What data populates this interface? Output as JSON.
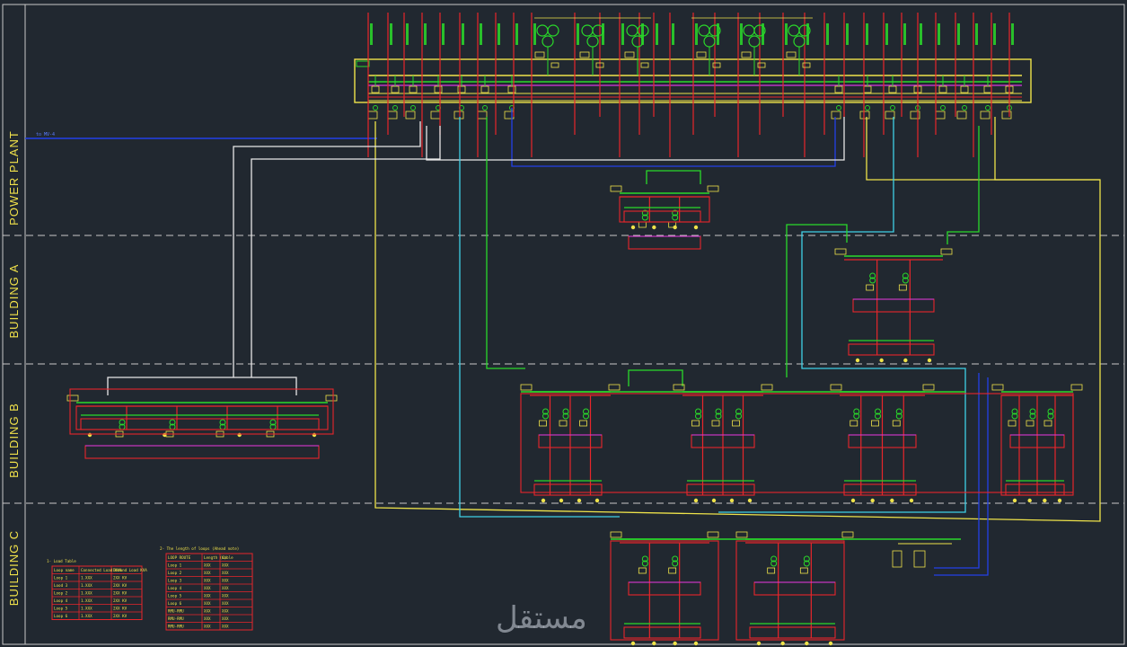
{
  "zones": [
    "POWER PLANT",
    "BUILDING A",
    "BUILDING B",
    "BUILDING C"
  ],
  "incoming_feeder": "to MV-4",
  "load_table": {
    "title": "1- Load Table",
    "header": [
      "Loop name",
      "Connected Load KVA",
      "Demand Load KVA"
    ],
    "rows": [
      [
        "Loop 1",
        "1.XXX",
        "2XX KV"
      ],
      [
        "Lood 3",
        "1.XXX",
        "2XX KV"
      ],
      [
        "Loop 2",
        "1.XXX",
        "2XX KV"
      ],
      [
        "Loop 4",
        "1.XXX",
        "2XX KV"
      ],
      [
        "Loop 5",
        "1.XXX",
        "2XX KV"
      ],
      [
        "Loop 6",
        "1.XXX",
        "2XX KV"
      ]
    ]
  },
  "cable_table": {
    "title": "2- The length of loops (Ahead note)",
    "header": [
      "LOOP ROUTE",
      "Length",
      "(m)",
      "Cable"
    ],
    "rows": [
      [
        "Loop 1",
        "XXX",
        "XXX"
      ],
      [
        "Loop 2",
        "XXX",
        "XXX"
      ],
      [
        "Loop 3",
        "XXX",
        "XXX"
      ],
      [
        "Loop 4",
        "XXX",
        "XXX"
      ],
      [
        "Loop 5",
        "XXX",
        "XXX"
      ],
      [
        "Loop 6",
        "XXX",
        "XXX"
      ],
      [
        "RMU-RMU",
        "XXX",
        "XXX"
      ],
      [
        "RMU-RMU",
        "XXX",
        "XXX"
      ],
      [
        "RMU-RMU",
        "XXX",
        "XXX"
      ]
    ]
  },
  "watermark": "مستقل",
  "colors": {
    "background": "#212830",
    "red": "#e8262b",
    "yellow": "#efe34a",
    "green": "#2ad92a",
    "cyan": "#3fd0e6",
    "blue": "#2340e8",
    "white": "#e8e8e8",
    "magenta": "#d838e0",
    "dash": "#c9c9c9"
  }
}
